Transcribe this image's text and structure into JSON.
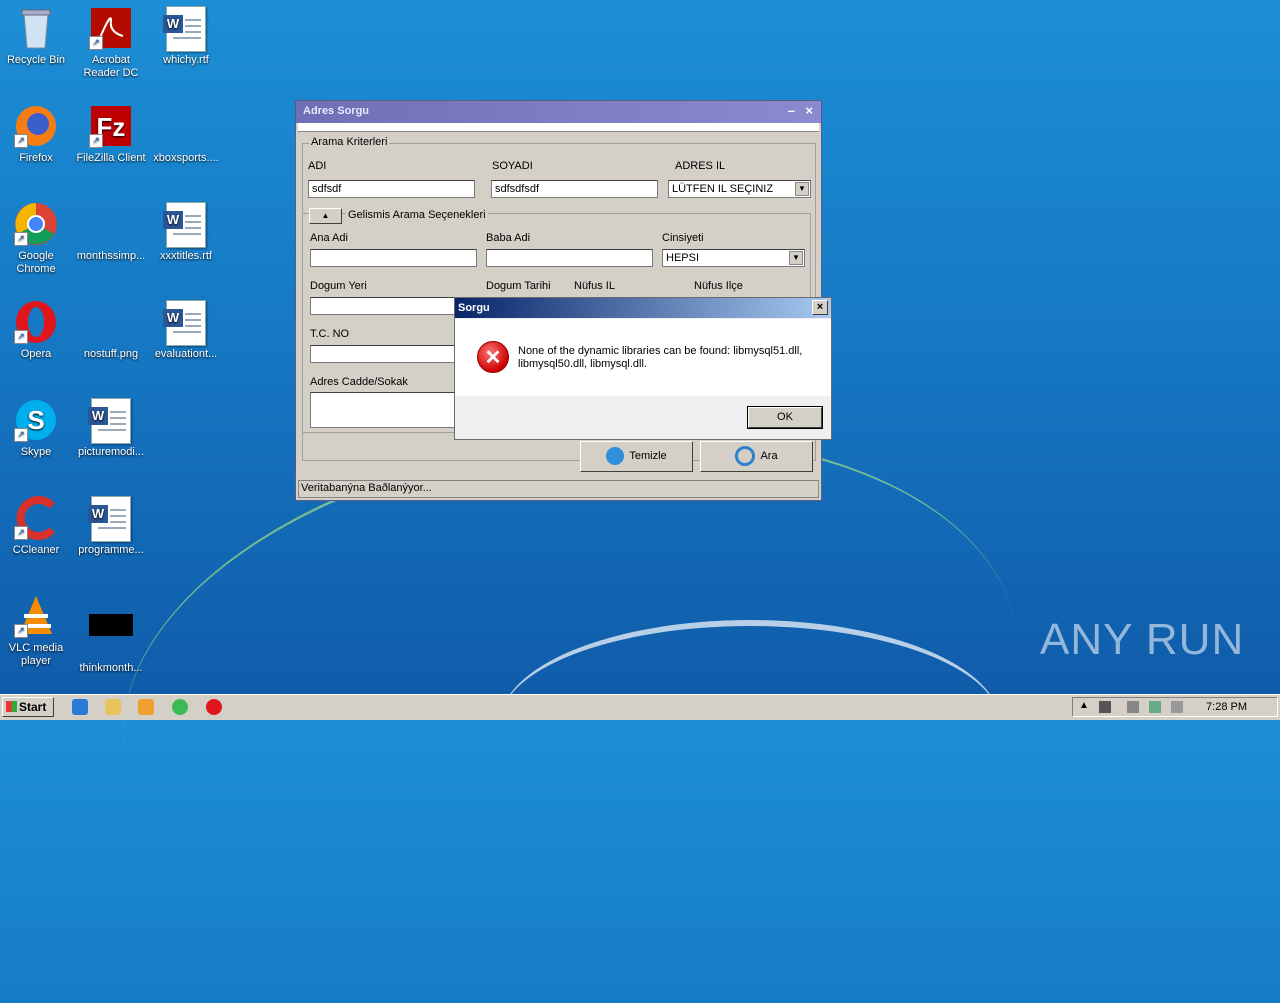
{
  "desktop": {
    "icons": [
      {
        "label": "Recycle Bin"
      },
      {
        "label": "Acrobat Reader DC"
      },
      {
        "label": "whichy.rtf"
      },
      {
        "label": "Firefox"
      },
      {
        "label": "FileZilla Client"
      },
      {
        "label": "xboxsports...."
      },
      {
        "label": "Google Chrome"
      },
      {
        "label": "monthssimp..."
      },
      {
        "label": "xxxtitles.rtf"
      },
      {
        "label": "Opera"
      },
      {
        "label": "nostuff.png"
      },
      {
        "label": "evaluationt..."
      },
      {
        "label": "Skype"
      },
      {
        "label": "picturemodi..."
      },
      {
        "label": "CCleaner"
      },
      {
        "label": "programme..."
      },
      {
        "label": "VLC media player"
      },
      {
        "label": "thinkmonth..."
      }
    ],
    "watermark": "ANY RUN"
  },
  "app_window": {
    "title": "Adres Sorgu",
    "minimize": "–",
    "close": "×",
    "criteria_legend": "Arama Kriterleri",
    "adi_label": "ADI",
    "adi_value": "sdfsdf",
    "soyadi_label": "SOYADI",
    "soyadi_value": "sdfsdfsdf",
    "adres_il_label": "ADRES IL",
    "adres_il_value": "LÜTFEN IL SEÇINIZ",
    "advanced_legend": "Gelismis Arama Seçenekleri",
    "ana_adi_label": "Ana Adi",
    "baba_adi_label": "Baba Adi",
    "cinsiyeti_label": "Cinsiyeti",
    "cinsiyeti_value": "HEPSI",
    "dogum_yeri_label": "Dogum Yeri",
    "dogum_tarihi_label": "Dogum Tarihi",
    "nufus_il_label": "Nüfus IL",
    "nufus_ilce_label": "Nüfus Ilçe",
    "tc_no_label": "T.C. NO",
    "adres_cadde_label": "Adres Cadde/Sokak",
    "temizle_label": "Temizle",
    "ara_label": "Ara",
    "status": "Veritabanýna Baðlanýyor..."
  },
  "dialog": {
    "title": "Sorgu",
    "close": "×",
    "message": "None of the dynamic libraries can be found: libmysql51.dll, libmysql50.dll, libmysql.dll.",
    "ok_label": "OK"
  },
  "taskbar": {
    "start_label": "Start",
    "clock": "7:28 PM"
  }
}
